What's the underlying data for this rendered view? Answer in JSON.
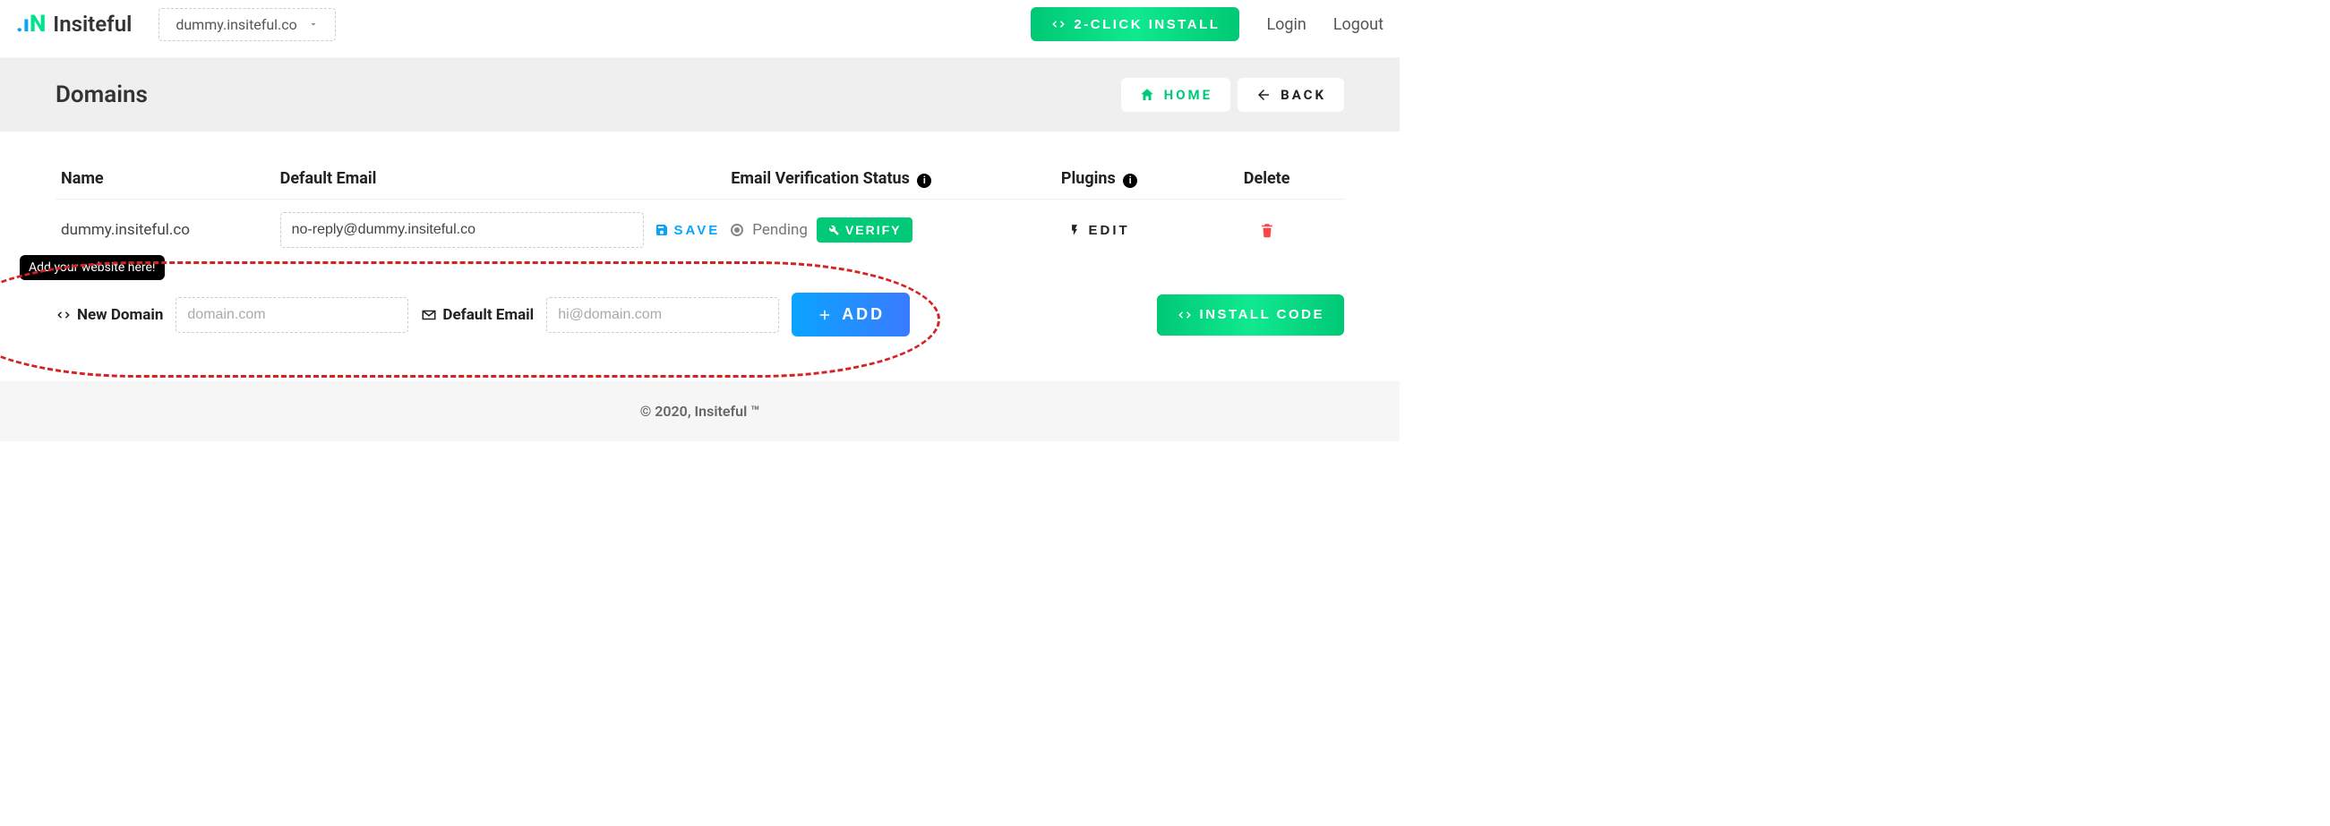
{
  "brand": {
    "name": "Insiteful"
  },
  "header": {
    "selected_domain": "dummy.insiteful.co",
    "install_label": "2-CLICK INSTALL",
    "login_label": "Login",
    "logout_label": "Logout"
  },
  "title_band": {
    "title": "Domains",
    "home_label": "HOME",
    "back_label": "BACK"
  },
  "table": {
    "headers": {
      "name": "Name",
      "default_email": "Default Email",
      "verification": "Email Verification Status",
      "plugins": "Plugins",
      "delete": "Delete"
    },
    "row": {
      "name": "dummy.insiteful.co",
      "email_value": "no-reply@dummy.insiteful.co",
      "save_label": "SAVE",
      "pending_label": "Pending",
      "verify_label": "VERIFY",
      "edit_label": "EDIT"
    }
  },
  "new_domain": {
    "tooltip": "Add your website here!",
    "label": "New Domain",
    "domain_placeholder": "domain.com",
    "email_label": "Default Email",
    "email_placeholder": "hi@domain.com",
    "add_label": "ADD",
    "install_code_label": "INSTALL CODE"
  },
  "footer": {
    "text": "© 2020, Insiteful ™"
  }
}
